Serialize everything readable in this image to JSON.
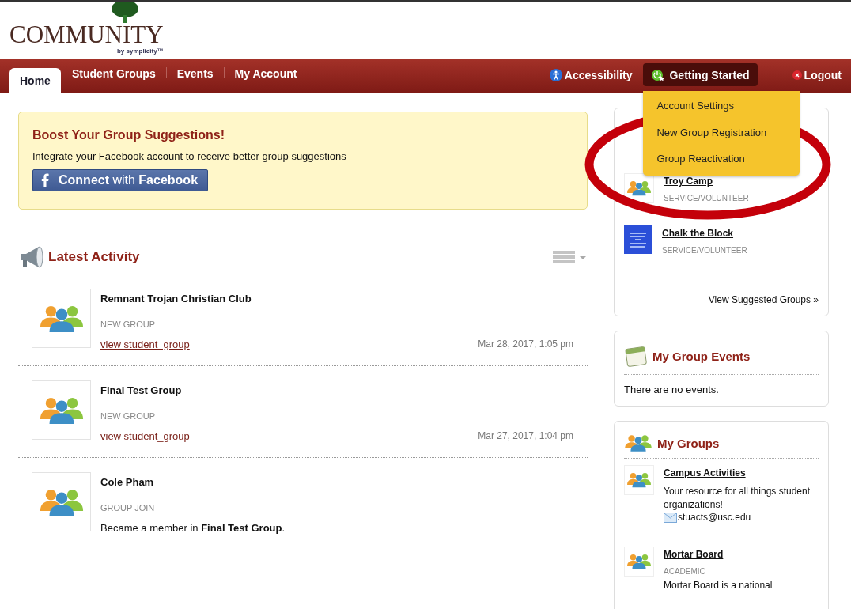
{
  "header": {
    "logo": "COMMUNITY",
    "byline": "by symplicity™"
  },
  "nav": {
    "tabs": [
      {
        "label": "Home",
        "selected": true
      },
      {
        "label": "Student Groups",
        "selected": false
      },
      {
        "label": "Events",
        "selected": false
      },
      {
        "label": "My Account",
        "selected": false
      }
    ],
    "accessibility": "Accessibility",
    "getting_started": {
      "label": "Getting Started",
      "expanded": true,
      "menu": [
        "Account Settings",
        "New Group Registration",
        "Group Reactivation"
      ]
    },
    "logout": "Logout"
  },
  "promo": {
    "title": "Boost Your Group Suggestions!",
    "text": "Integrate your Facebook account to receive better ",
    "link": "group suggestions",
    "button": "**Connect** with **Facebook**"
  },
  "activity": {
    "title": "Latest Activity",
    "items": [
      {
        "title": "Remnant Trojan Christian Club",
        "type": "NEW GROUP",
        "link": "view student_group",
        "date": "Mar 28, 2017, 1:05 pm"
      },
      {
        "title": "Final Test Group",
        "type": "NEW GROUP",
        "link": "view student_group",
        "date": "Mar 27, 2017, 1:04 pm"
      },
      {
        "title": "Cole Pham",
        "type": "GROUP JOIN",
        "text": "Became a member in **Final Test Group**."
      }
    ]
  },
  "suggested": {
    "items": [
      {
        "name": "Troy Camp",
        "category": "SERVICE/VOLUNTEER",
        "kind": "group"
      },
      {
        "name": "Chalk the Block",
        "category": "SERVICE/VOLUNTEER",
        "kind": "logo"
      }
    ],
    "link": "View Suggested Groups »"
  },
  "events": {
    "title": "My Group Events",
    "empty": "There are no events."
  },
  "my_groups": {
    "title": "My Groups",
    "items": [
      {
        "name": "Campus Activities",
        "description": "Your resource for all things student organizations!",
        "email": "stuacts@usc.edu"
      },
      {
        "name": "Mortar Board",
        "category": "ACADEMIC",
        "description": "Mortar Board is a national"
      }
    ]
  }
}
